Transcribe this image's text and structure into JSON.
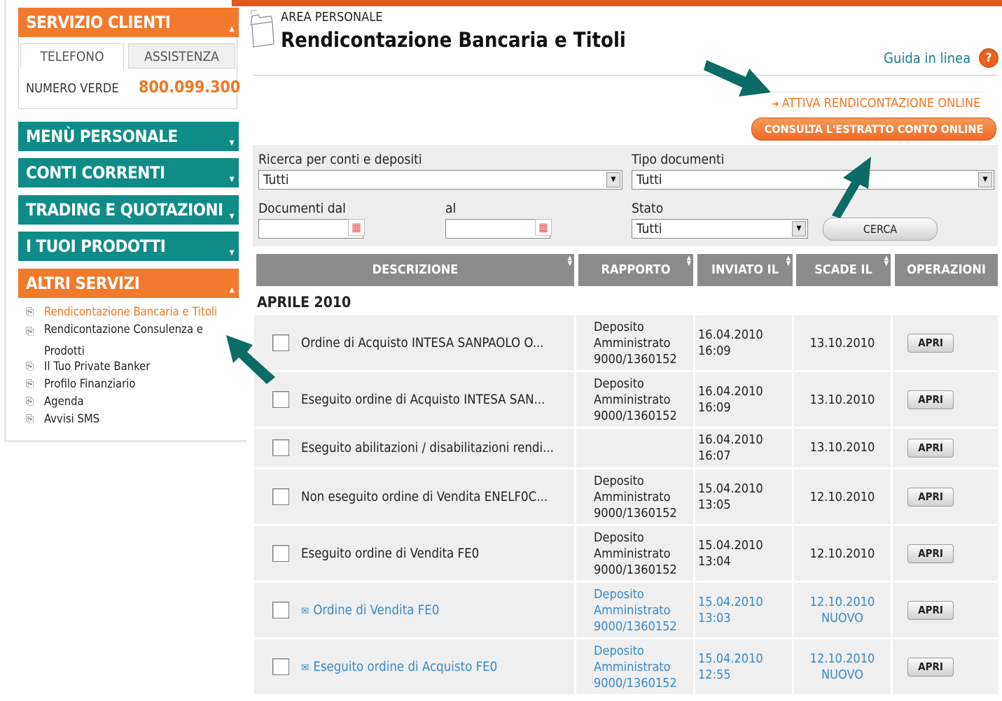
{
  "header": {
    "area_label": "AREA PERSONALE",
    "title": "Rendicontazione Bancaria e Titoli",
    "guide_link": "Guida in linea",
    "help_icon_text": "?",
    "activate_link": "ATTIVA RENDICONTAZIONE ONLINE",
    "consult_button": "CONSULTA L'ESTRATTO CONTO ONLINE"
  },
  "sidebar": {
    "servizio_clienti": {
      "title": "SERVIZIO CLIENTI",
      "tabs": [
        "TELEFONO",
        "ASSISTENZA"
      ],
      "numero_verde_label": "NUMERO VERDE",
      "numero_verde": "800.099.300"
    },
    "menus": [
      "MENÙ PERSONALE",
      "CONTI CORRENTI",
      "TRADING E QUOTAZIONI",
      "I TUOI PRODOTTI"
    ],
    "altri_servizi": {
      "title": "ALTRI SERVIZI",
      "items": [
        "Rendicontazione Bancaria e Titoli",
        "Rendicontazione Consulenza e Prodotti",
        "Il Tuo Private Banker",
        "Profilo Finanziario",
        "Agenda",
        "Avvisi SMS"
      ]
    }
  },
  "filters": {
    "conti_label": "Ricerca per conti e depositi",
    "conti_value": "Tutti",
    "tipo_label": "Tipo documenti",
    "tipo_value": "Tutti",
    "dal_label": "Documenti dal",
    "al_label": "al",
    "stato_label": "Stato",
    "stato_value": "Tutti",
    "search_button": "CERCA"
  },
  "table": {
    "columns": [
      "DESCRIZIONE",
      "RAPPORTO",
      "INVIATO IL",
      "SCADE IL",
      "OPERAZIONI"
    ],
    "group": "APRILE 2010",
    "open_label": "APRI",
    "rows": [
      {
        "desc": "Ordine di Acquisto INTESA SANPAOLO O...",
        "rap": [
          "Deposito",
          "Amministrato",
          "9000/1360152"
        ],
        "sent_date": "16.04.2010",
        "sent_time": "16:09",
        "due": "13.10.2010",
        "status": "",
        "unread": false
      },
      {
        "desc": "Eseguito ordine di Acquisto INTESA SAN...",
        "rap": [
          "Deposito",
          "Amministrato",
          "9000/1360152"
        ],
        "sent_date": "16.04.2010",
        "sent_time": "16:09",
        "due": "13.10.2010",
        "status": "",
        "unread": false
      },
      {
        "desc": "Eseguito abilitazioni / disabilitazioni rendi...",
        "rap": [
          "",
          "",
          ""
        ],
        "sent_date": "16.04.2010",
        "sent_time": "16:07",
        "due": "13.10.2010",
        "status": "",
        "unread": false
      },
      {
        "desc": "Non eseguito ordine di Vendita ENELF0C...",
        "rap": [
          "Deposito",
          "Amministrato",
          "9000/1360152"
        ],
        "sent_date": "15.04.2010",
        "sent_time": "13:05",
        "due": "12.10.2010",
        "status": "",
        "unread": false
      },
      {
        "desc": "Eseguito ordine di Vendita FE0",
        "rap": [
          "Deposito",
          "Amministrato",
          "9000/1360152"
        ],
        "sent_date": "15.04.2010",
        "sent_time": "13:04",
        "due": "12.10.2010",
        "status": "",
        "unread": false
      },
      {
        "desc": "Ordine di Vendita FE0",
        "rap": [
          "Deposito",
          "Amministrato",
          "9000/1360152"
        ],
        "sent_date": "15.04.2010",
        "sent_time": "13:03",
        "due": "12.10.2010",
        "status": "NUOVO",
        "unread": true
      },
      {
        "desc": "Eseguito ordine di Acquisto FE0",
        "rap": [
          "Deposito",
          "Amministrato",
          "9000/1360152"
        ],
        "sent_date": "15.04.2010",
        "sent_time": "12:55",
        "due": "12.10.2010",
        "status": "NUOVO",
        "unread": true
      }
    ]
  },
  "icons": {
    "doc_icon": "⎘",
    "mail_icon": "✉",
    "calendar_icon": "▦",
    "dropdown_icon": "▼"
  },
  "colors": {
    "orange": "#f37a2c",
    "teal": "#0f8c88",
    "arrow": "#0c6b64",
    "link_blue": "#3a8ac8"
  }
}
